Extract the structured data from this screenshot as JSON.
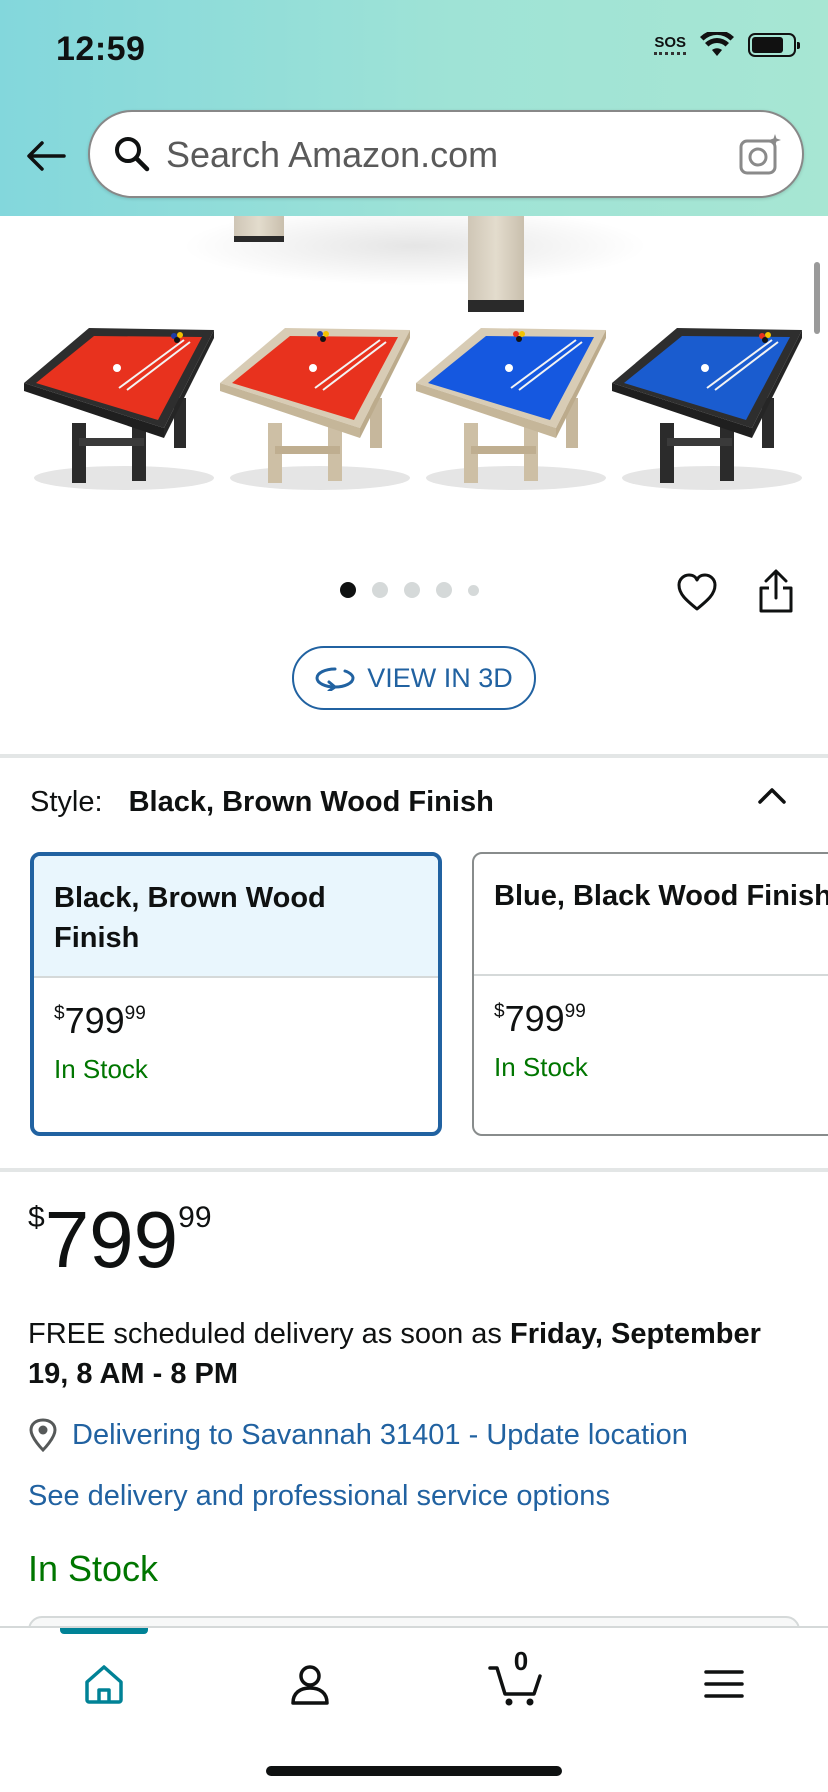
{
  "status_bar": {
    "time": "12:59",
    "sos": "SOS"
  },
  "search": {
    "placeholder": "Search Amazon.com"
  },
  "gallery": {
    "dots": 5,
    "active_dot": 1,
    "view3d_label": "VIEW IN 3D"
  },
  "style_selector": {
    "label": "Style:",
    "selected": "Black, Brown Wood Finish",
    "options": [
      {
        "name": "Black, Brown Wood Finish",
        "price_symbol": "$",
        "price_whole": "799",
        "price_fraction": "99",
        "stock": "In Stock"
      },
      {
        "name": "Blue, Black Wood Finish",
        "price_symbol": "$",
        "price_whole": "799",
        "price_fraction": "99",
        "stock": "In Stock"
      }
    ]
  },
  "price": {
    "symbol": "$",
    "whole": "799",
    "fraction": "99"
  },
  "delivery": {
    "prefix": "FREE scheduled delivery as soon as ",
    "date": "Friday, September 19, 8 AM - 8 PM",
    "location": "Delivering to Savannah 31401 - Update location",
    "service_link": "See delivery and professional service options",
    "stock": "In Stock"
  },
  "bottom_nav": {
    "cart_count": "0"
  },
  "colors": {
    "accent_link": "#2162a1",
    "in_stock": "#007600",
    "nav_active": "#008296",
    "header_gradient_start": "#83d7dc",
    "header_gradient_end": "#a7e6d3"
  }
}
